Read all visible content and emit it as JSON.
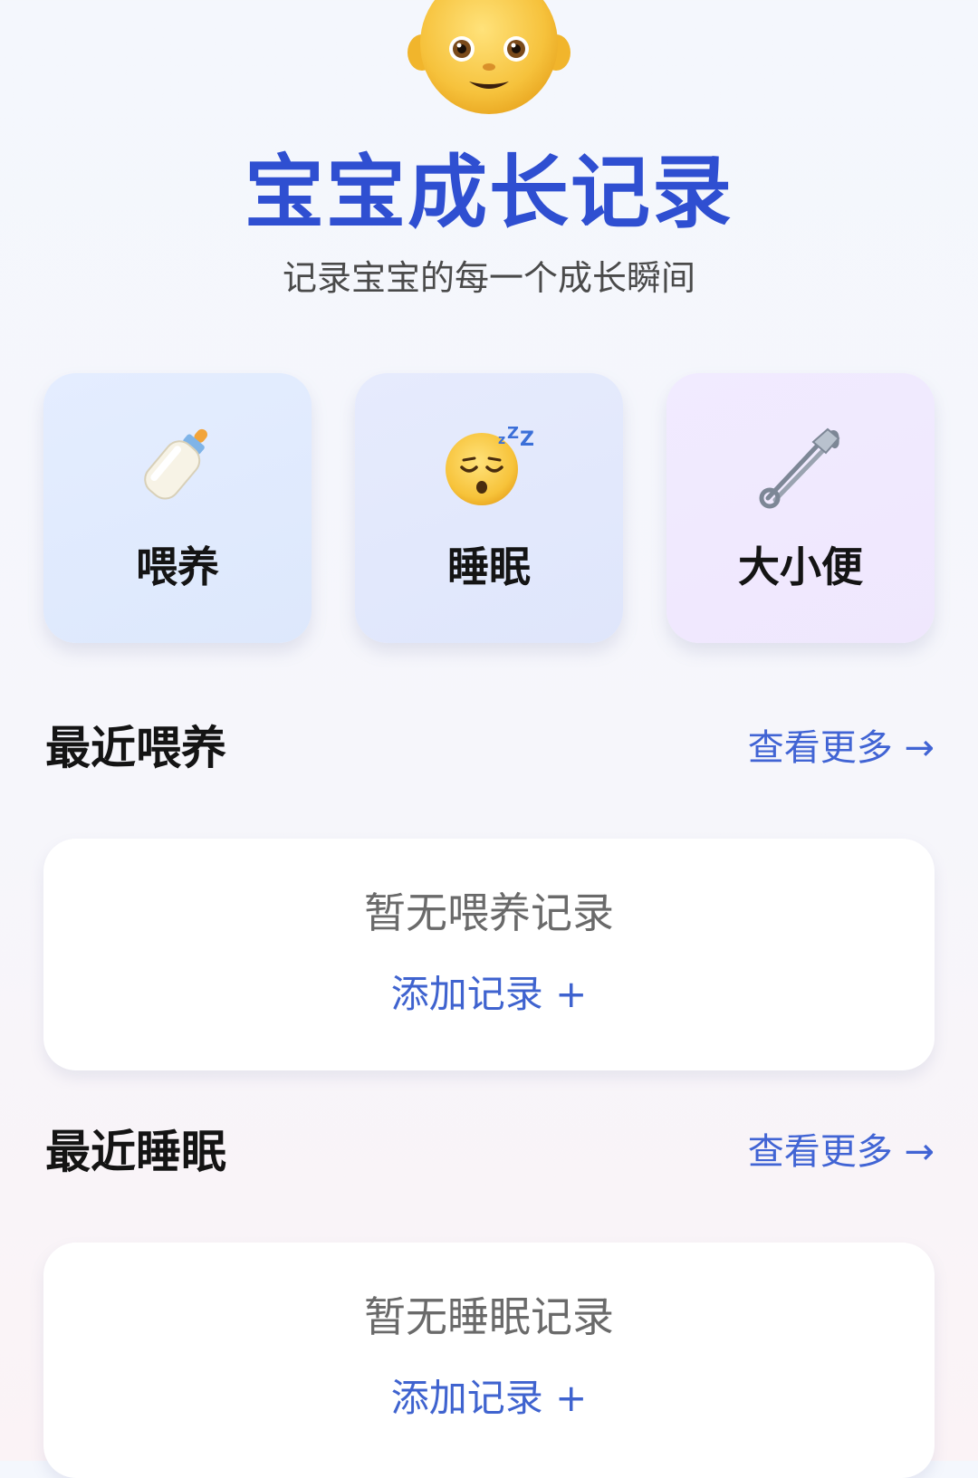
{
  "header": {
    "avatar_icon": "baby-face-icon",
    "title": "宝宝成长记录",
    "subtitle": "记录宝宝的每一个成长瞬间",
    "title_color": "#2f4fd1"
  },
  "quick_actions": [
    {
      "label": "喂养",
      "icon": "baby-bottle-icon",
      "background": "#e2ebfe"
    },
    {
      "label": "睡眠",
      "icon": "sleeping-face-icon",
      "background": "#e3e8fc"
    },
    {
      "label": "大小便",
      "icon": "safety-pin-icon",
      "background": "#f0e9fe"
    }
  ],
  "sections": {
    "feeding": {
      "title": "最近喂养",
      "view_more": "查看更多 →",
      "empty_text": "暂无喂养记录",
      "add_label": "添加记录 +"
    },
    "sleep": {
      "title": "最近睡眠",
      "view_more": "查看更多 →",
      "empty_text": "暂无睡眠记录",
      "add_label": "添加记录 +"
    }
  },
  "colors": {
    "accent": "#4164d4"
  }
}
